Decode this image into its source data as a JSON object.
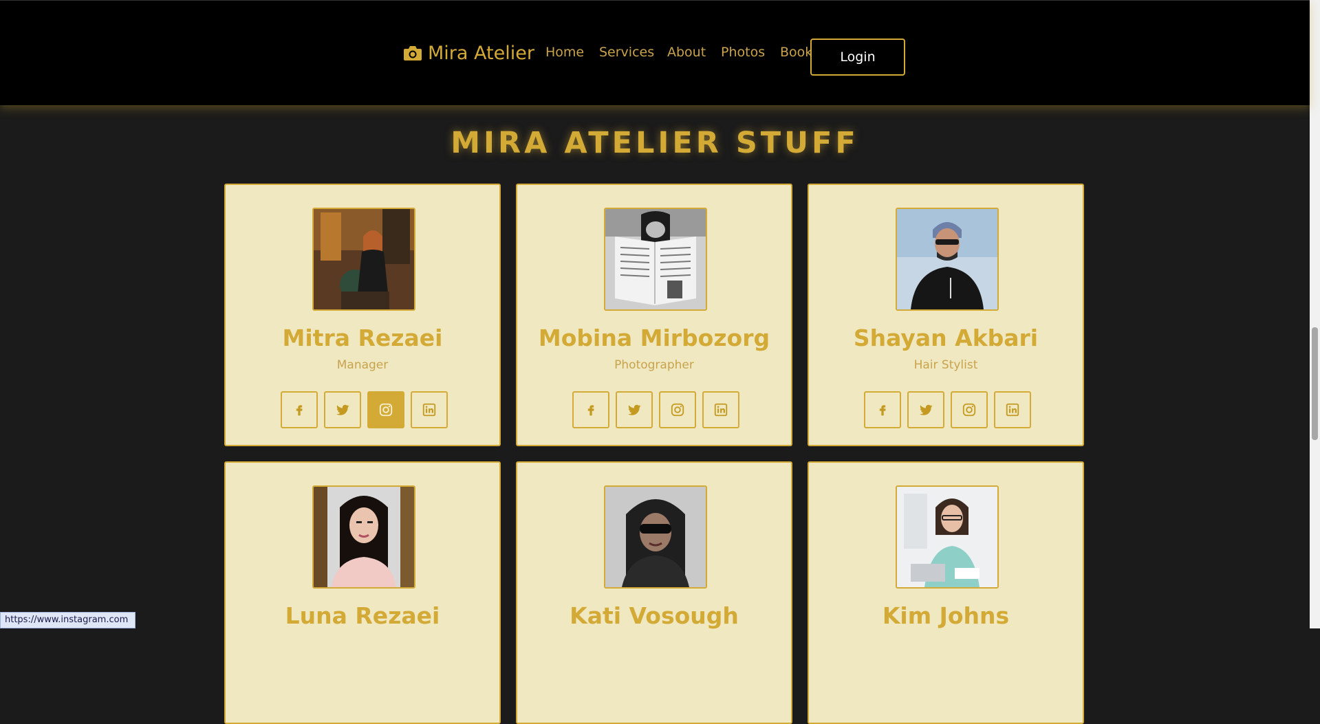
{
  "header": {
    "brand": "Mira Atelier",
    "nav": [
      "Home",
      "Services",
      "About",
      "Photos",
      "Book"
    ],
    "login": "Login"
  },
  "section_title": "MIRA ATELIER STUFF",
  "staff": [
    {
      "name": "Mitra Rezaei",
      "role": "Manager"
    },
    {
      "name": "Mobina Mirbozorg",
      "role": "Photographer"
    },
    {
      "name": "Shayan Akbari",
      "role": "Hair Stylist"
    },
    {
      "name": "Luna Rezaei",
      "role": ""
    },
    {
      "name": "Kati Vosough",
      "role": ""
    },
    {
      "name": "Kim Johns",
      "role": ""
    }
  ],
  "status_url": "https://www.instagram.com",
  "colors": {
    "accent": "#d4aa36",
    "card_bg": "#efe8c1",
    "page_bg": "#1b1b1b",
    "header_bg": "#000000"
  },
  "icons": [
    "camera-icon",
    "facebook-icon",
    "twitter-icon",
    "instagram-icon",
    "linkedin-icon"
  ]
}
